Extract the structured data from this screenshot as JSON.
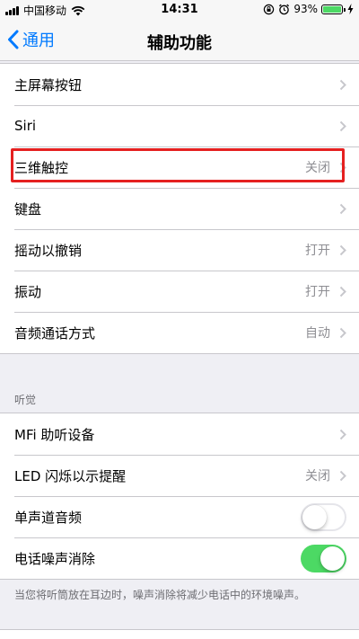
{
  "status_bar": {
    "carrier": "中国移动",
    "time": "14:31",
    "battery_percent": "93%"
  },
  "nav": {
    "back_label": "通用",
    "title": "辅助功能"
  },
  "group1": {
    "rows": [
      {
        "label": "主屏幕按钮",
        "value": ""
      },
      {
        "label": "Siri",
        "value": ""
      },
      {
        "label": "三维触控",
        "value": "关闭"
      },
      {
        "label": "键盘",
        "value": ""
      },
      {
        "label": "摇动以撤销",
        "value": "打开"
      },
      {
        "label": "振动",
        "value": "打开"
      },
      {
        "label": "音频通话方式",
        "value": "自动"
      }
    ]
  },
  "hearing": {
    "header": "听觉",
    "rows": [
      {
        "label": "MFi 助听设备",
        "value": ""
      },
      {
        "label": "LED 闪烁以示提醒",
        "value": "关闭"
      },
      {
        "label": "单声道音频",
        "toggle": false
      },
      {
        "label": "电话噪声消除",
        "toggle": true
      }
    ],
    "footer": "当您将听筒放在耳边时，噪声消除将减少电话中的环境噪声。"
  },
  "colors": {
    "accent": "#007aff",
    "toggle_on": "#4cd964",
    "highlight": "#e52020"
  },
  "icons": [
    "signal-icon",
    "wifi-icon",
    "lock-rotation-icon",
    "alarm-icon",
    "battery-icon",
    "charging-icon",
    "back-chevron-icon",
    "chevron-right-icon"
  ]
}
